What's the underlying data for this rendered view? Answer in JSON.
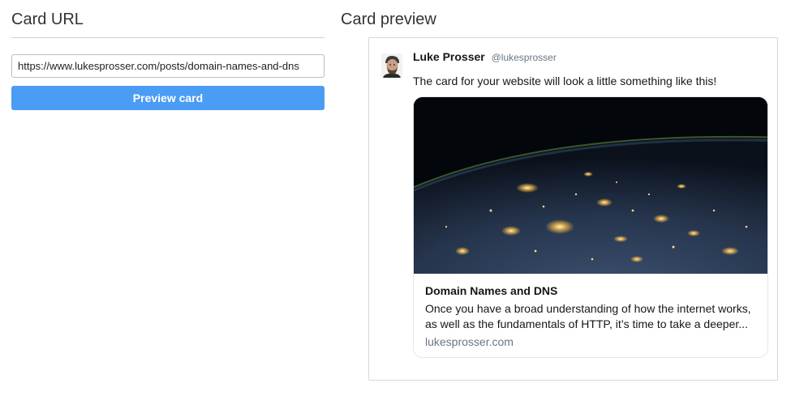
{
  "url_section": {
    "title": "Card URL",
    "url_value": "https://www.lukesprosser.com/posts/domain-names-and-dns",
    "button_label": "Preview card"
  },
  "preview_section": {
    "title": "Card preview",
    "tweet": {
      "author_name": "Luke Prosser",
      "author_handle": "@lukesprosser",
      "text": "The card for your website will look a little something like this!",
      "card": {
        "title": "Domain Names and DNS",
        "description": "Once you have a broad understanding of how the internet works, as well as the fundamentals of HTTP, it’s time to take a deeper...",
        "domain": "lukesprosser.com"
      }
    }
  },
  "colors": {
    "button_bg": "#4a9cf5",
    "handle": "#657786"
  },
  "icons": {
    "avatar": "user-avatar-photo",
    "card_image": "earth-at-night-image"
  }
}
